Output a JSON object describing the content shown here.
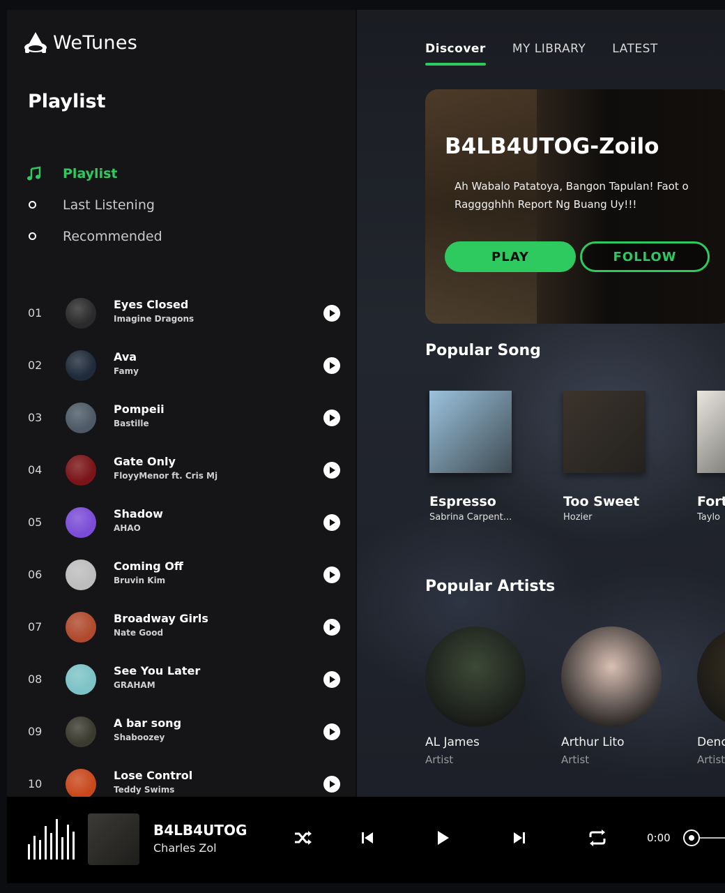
{
  "app": {
    "name": "WeTunes"
  },
  "sidebar": {
    "title": "Playlist",
    "menu": [
      {
        "label": "Playlist",
        "icon": "music-note-icon",
        "active": true
      },
      {
        "label": "Last Listening",
        "icon": "circle-icon",
        "active": false
      },
      {
        "label": "Recommended",
        "icon": "circle-icon",
        "active": false
      }
    ],
    "tracks": [
      {
        "num": "01",
        "title": "Eyes Closed",
        "artist": "Imagine Dragons",
        "color": "#2a2a2a"
      },
      {
        "num": "02",
        "title": "Ava",
        "artist": "Famy",
        "color": "#1f2b3a"
      },
      {
        "num": "03",
        "title": "Pompeii",
        "artist": "Bastille",
        "color": "#4d5a66"
      },
      {
        "num": "04",
        "title": "Gate Only",
        "artist": "FloyyMenor ft. Cris Mj",
        "color": "#7a1418"
      },
      {
        "num": "05",
        "title": "Shadow",
        "artist": "AHAO",
        "color": "#7b4cd6"
      },
      {
        "num": "06",
        "title": "Coming Off",
        "artist": "Bruvin Kim",
        "color": "#bdbdbd"
      },
      {
        "num": "07",
        "title": "Broadway Girls",
        "artist": "Nate Good",
        "color": "#b04a2e"
      },
      {
        "num": "08",
        "title": "See You Later",
        "artist": "GRAHAM",
        "color": "#7cc2c6"
      },
      {
        "num": "09",
        "title": "A bar song",
        "artist": "Shaboozey",
        "color": "#3a3a2e"
      },
      {
        "num": "10",
        "title": "Lose Control",
        "artist": "Teddy Swims",
        "color": "#c8481c"
      }
    ]
  },
  "tabs": [
    {
      "label": "Discover",
      "active": true
    },
    {
      "label": "MY LIBRARY",
      "active": false
    },
    {
      "label": "LATEST",
      "active": false
    }
  ],
  "hero": {
    "title": "B4LB4UTOG-Zoilo",
    "description": "Ah Wabalo Patatoya, Bangon Tapulan! Faot o Ragggghhh Report Ng Buang Uy!!!",
    "play_label": "PLAY",
    "follow_label": "FOLLOW"
  },
  "popular_songs": {
    "title": "Popular Song",
    "items": [
      {
        "title": "Espresso",
        "artist": "Sabrina Carpent...",
        "color": "#9bc3dd"
      },
      {
        "title": "Too Sweet",
        "artist": "Hozier",
        "color": "#3b342c"
      },
      {
        "title": "Fort",
        "artist": "Taylo",
        "color": "#e9e6df"
      }
    ]
  },
  "popular_artists": {
    "title": "Popular Artists",
    "items": [
      {
        "name": "AL James",
        "role": "Artist",
        "color": "#3c4a36"
      },
      {
        "name": "Arthur Lito",
        "role": "Artist",
        "color": "#d9c0b4"
      },
      {
        "name": "Denc",
        "role": "Artist",
        "color": "#3a3220"
      }
    ]
  },
  "player": {
    "title": "B4LB4UTOG",
    "artist": "Charles Zol",
    "time": "0:00",
    "progress": 0
  },
  "colors": {
    "accent": "#2ec95f",
    "sidebar_bg": "#151517",
    "player_bg": "#000000"
  }
}
